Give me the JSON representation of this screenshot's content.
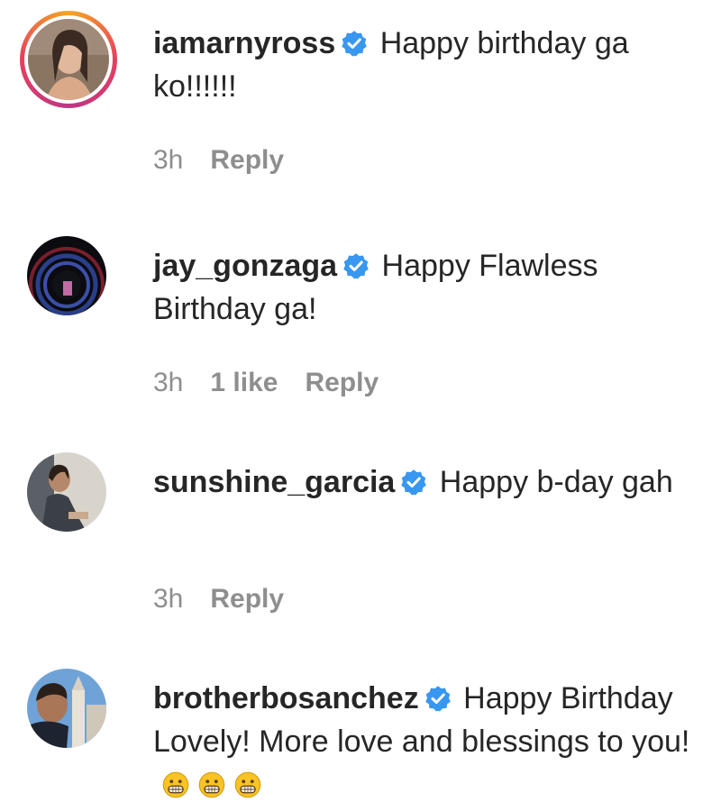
{
  "colors": {
    "text": "#262626",
    "meta": "#8e8e8e",
    "verified_badge": "#3897f0"
  },
  "comments": [
    {
      "username": "iamarnyross",
      "verified": true,
      "text": "Happy birthday ga ko!!!!!!",
      "time": "3h",
      "likes": "",
      "reply_label": "Reply",
      "avatar_has_story_ring": true
    },
    {
      "username": "jay_gonzaga",
      "verified": true,
      "text": "Happy Flawless Birthday ga!",
      "time": "3h",
      "likes": "1 like",
      "reply_label": "Reply",
      "avatar_has_story_ring": false
    },
    {
      "username": "sunshine_garcia",
      "verified": true,
      "text": "Happy b-day gah",
      "time": "3h",
      "likes": "",
      "reply_label": "Reply",
      "avatar_has_story_ring": false
    },
    {
      "username": "brotherbosanchez",
      "verified": true,
      "text": "Happy Birthday Lovely! More love and blessings to you!",
      "emojis": [
        "grinning-face-icon",
        "grinning-face-icon",
        "grinning-face-icon"
      ],
      "time": "",
      "likes": "",
      "reply_label": "",
      "avatar_has_story_ring": false
    }
  ]
}
